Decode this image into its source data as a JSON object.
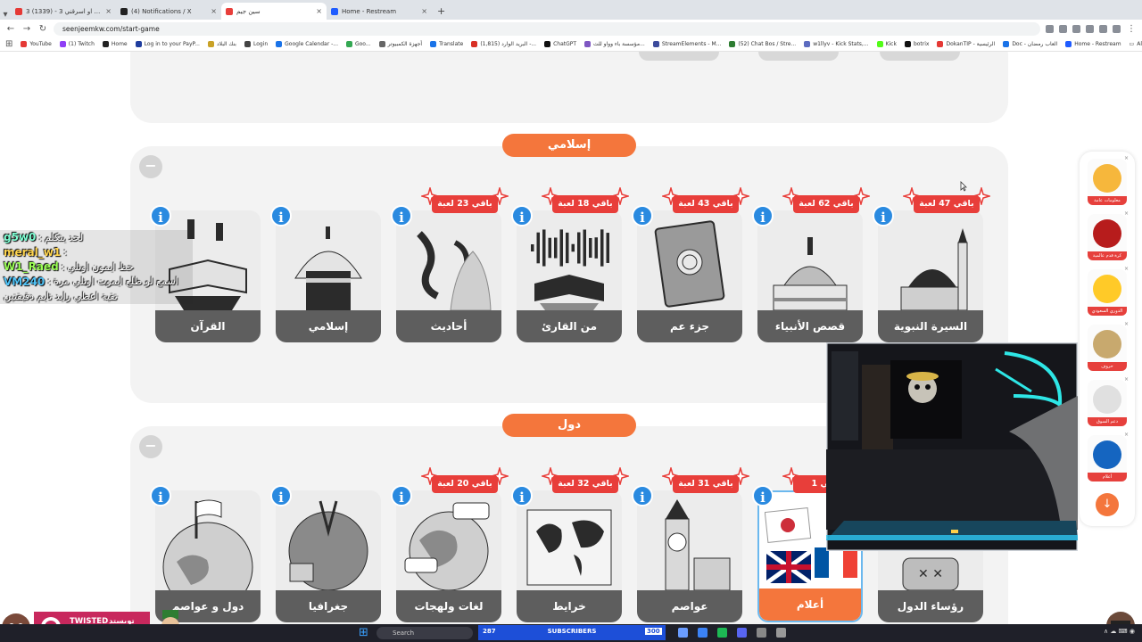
{
  "browser": {
    "tabs": [
      {
        "title": "شاركني او اسرقني 3 - (1339) 3e",
        "fav": "#e53935"
      },
      {
        "title": "(4) Notifications / X",
        "fav": "#222"
      },
      {
        "title": "سين جيم",
        "fav": "#e83e3a",
        "active": true
      },
      {
        "title": "Home - Restream",
        "fav": "#1f5cff"
      }
    ],
    "url": "seenjeemkw.com/start-game",
    "bookmarks": [
      {
        "label": "YouTube",
        "fav": "#e53935"
      },
      {
        "label": "(1) Twitch",
        "fav": "#8f3ff6"
      },
      {
        "label": "Home",
        "fav": "#222"
      },
      {
        "label": "Log in to your PayP...",
        "fav": "#1f3d9e"
      },
      {
        "label": "بنك البلاد",
        "fav": "#c9a227"
      },
      {
        "label": "Login",
        "fav": "#444"
      },
      {
        "label": "Google Calendar -...",
        "fav": "#1a73e8"
      },
      {
        "label": "Goo...",
        "fav": "#34a853"
      },
      {
        "label": "أجهزة الكمبيوتر",
        "fav": "#666"
      },
      {
        "label": "Translate",
        "fav": "#1a73e8"
      },
      {
        "label": "(1,815) البريد الوارد -...",
        "fav": "#d93025"
      },
      {
        "label": "ChatGPT",
        "fav": "#111"
      },
      {
        "label": "مؤسسة باء وواو للت...",
        "fav": "#7e57c2"
      },
      {
        "label": "StreamElements - M...",
        "fav": "#3c4b9c"
      },
      {
        "label": "(52) Chat Bos / Stre...",
        "fav": "#2e7d32"
      },
      {
        "label": "w1llyv - Kick Stats,...",
        "fav": "#5c6bc0"
      },
      {
        "label": "Kick",
        "fav": "#53fc18"
      },
      {
        "label": "botrix",
        "fav": "#111"
      },
      {
        "label": "DokanTIP - الرئيسية",
        "fav": "#e53935"
      },
      {
        "label": "Doc - العاب رمضان",
        "fav": "#1a73e8"
      },
      {
        "label": "Home - Restream",
        "fav": "#1f5cff"
      }
    ],
    "all_bookmarks": "All Bookmarks"
  },
  "sections": [
    {
      "title": "إسلامي",
      "collapse_symbol": "−",
      "cards": [
        {
          "label": "السيرة النبوية",
          "badge": "باقي 47 لعبة",
          "icon": "mosque-dome-icon"
        },
        {
          "label": "قصص الأنبياء",
          "badge": "باقي 62 لعبة",
          "icon": "mosque-icon"
        },
        {
          "label": "جزء عم",
          "badge": "باقي 43 لعبة",
          "icon": "quran-book-icon"
        },
        {
          "label": "من القارئ",
          "badge": "باقي 18 لعبة",
          "icon": "reciter-soundwave-icon"
        },
        {
          "label": "أحاديث",
          "badge": "باقي 23 لعبة",
          "icon": "calligraphy-icon"
        },
        {
          "label": "إسلامي",
          "badge": "",
          "icon": "kaaba-icon"
        },
        {
          "label": "القرآن",
          "badge": "",
          "icon": "quran-stand-icon"
        }
      ]
    },
    {
      "title": "دول",
      "collapse_symbol": "−",
      "cards": [
        {
          "label": "رؤساء الدول",
          "badge": "",
          "icon": "president-chair-icon"
        },
        {
          "label": "أعلام",
          "badge": "باقي 1",
          "icon": "flags-icon",
          "selected": true
        },
        {
          "label": "عواصم",
          "badge": "باقي 31 لعبة",
          "icon": "big-ben-icon"
        },
        {
          "label": "خرايط",
          "badge": "باقي 32 لعبة",
          "icon": "world-map-icon"
        },
        {
          "label": "لغات ولهجات",
          "badge": "باقي 20 لعبة",
          "icon": "languages-globe-icon"
        },
        {
          "label": "جغرافيا",
          "badge": "",
          "icon": "geography-globe-icon"
        },
        {
          "label": "دول و عواصم",
          "badge": "",
          "icon": "globe-flag-icon"
        }
      ]
    }
  ],
  "info_symbol": "i",
  "chat": [
    {
      "name": "g5w0",
      "sep": " : ",
      "msg": "لحد يتكلم"
    },
    {
      "name": "meral_w1",
      "sep": " : ",
      "msg": ""
    },
    {
      "name": "W1_Raed",
      "sep": " : ",
      "msg": "حظ ايمون اونلي"
    },
    {
      "name": "VM240",
      "sep": " : ",
      "msg": "اسمع لو طلع ايموت اونلي مرة"
    },
    {
      "name": "",
      "sep": "",
      "msg": "تقية اعطي رايد تايم دقيقتين"
    }
  ],
  "sidebar": {
    "items": [
      {
        "label": "معلومات عامة",
        "icon": "general-info-icon"
      },
      {
        "label": "كرة قدم عالمية",
        "icon": "football-icon"
      },
      {
        "label": "الدوري السعودي",
        "icon": "saudi-league-icon"
      },
      {
        "label": "حروف",
        "icon": "letters-grid-icon"
      },
      {
        "label": "دعم السوق",
        "icon": "document-icon"
      },
      {
        "label": "أعلام",
        "icon": "flags-icon"
      }
    ],
    "down_arrow": "↓"
  },
  "taskbar": {
    "search": "Search",
    "subs_count": "287",
    "subs_label": "SUBSCRIBERS",
    "subs_goal": "300",
    "brand_en": "TWISTED\nMINDS",
    "brand_ar": "تويستد\nمايندز"
  }
}
